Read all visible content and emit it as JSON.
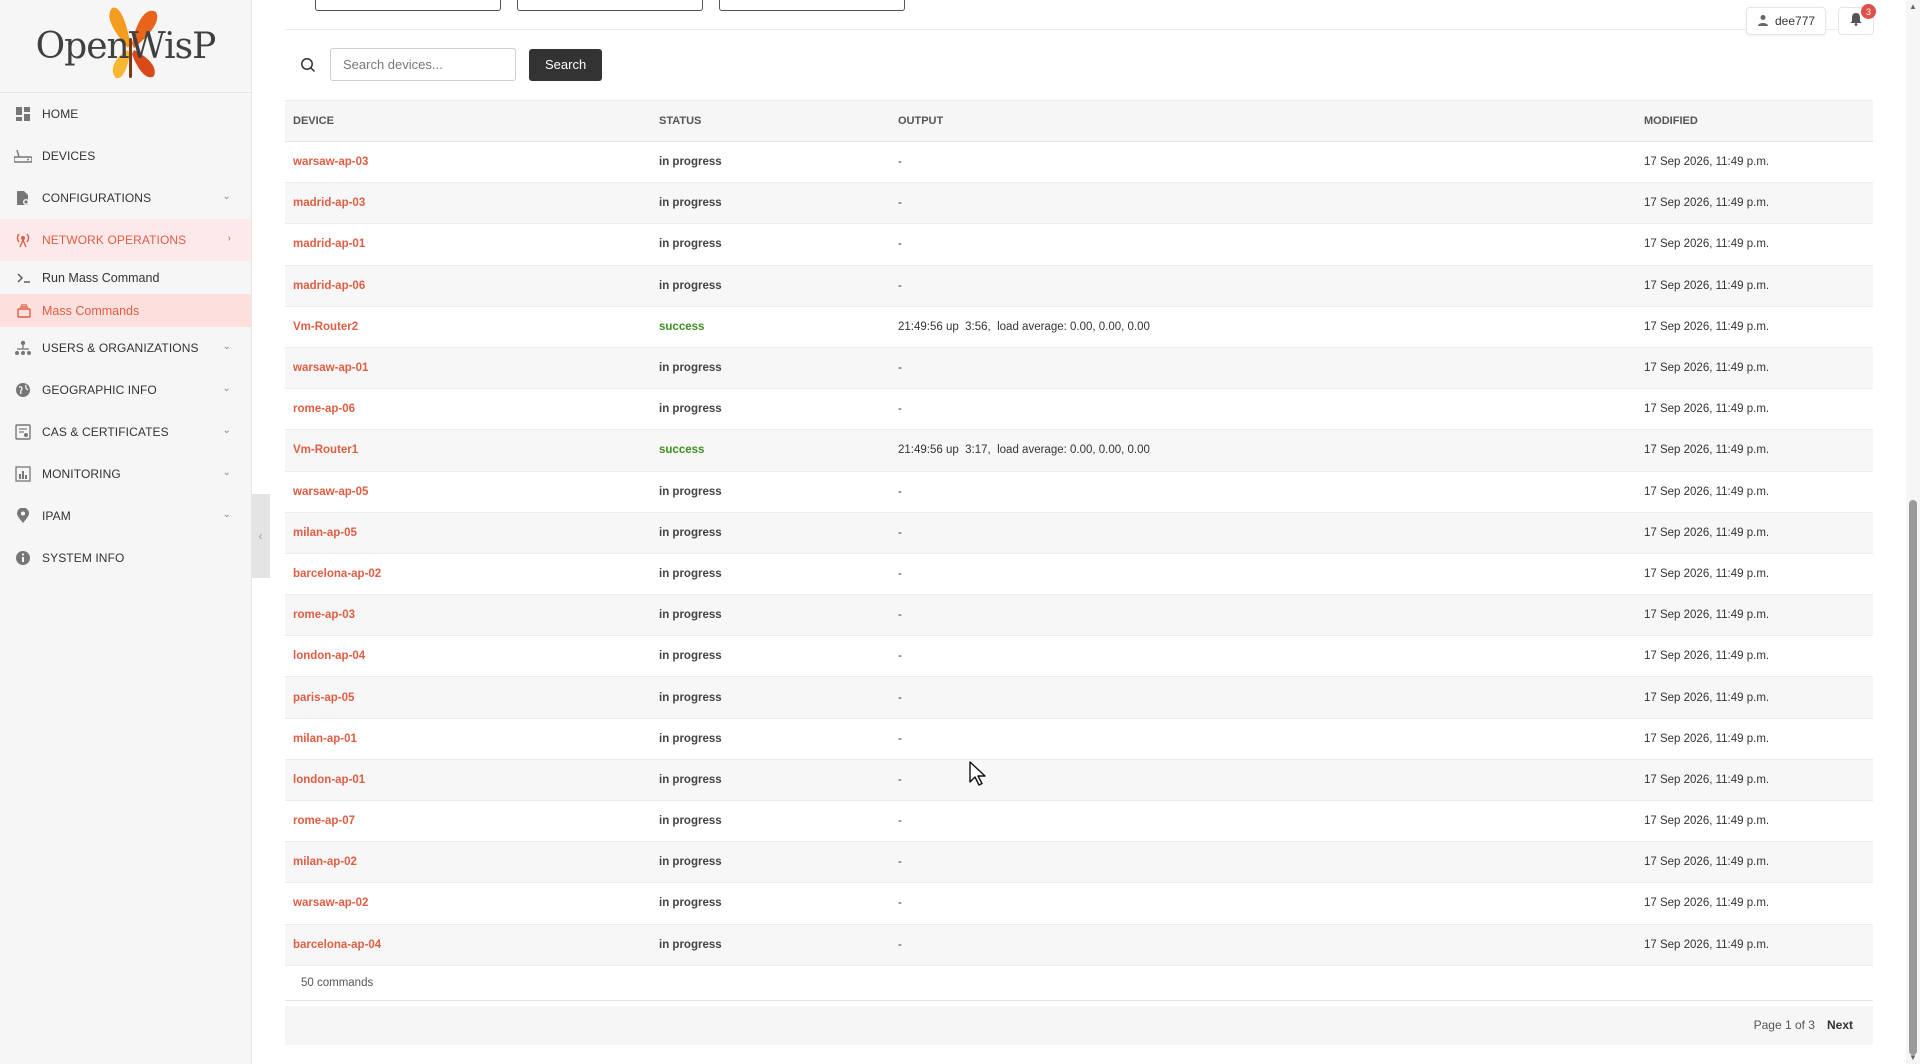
{
  "brand": {
    "logo_text": "OpenWisP"
  },
  "sidebar": {
    "items": [
      {
        "label": "HOME",
        "icon": "dashboard-icon"
      },
      {
        "label": "DEVICES",
        "icon": "router-icon"
      },
      {
        "label": "CONFIGURATIONS",
        "icon": "file-gear-icon"
      },
      {
        "label": "NETWORK OPERATIONS",
        "icon": "antenna-icon"
      },
      {
        "label": "USERS & ORGANIZATIONS",
        "icon": "org-tree-icon"
      },
      {
        "label": "GEOGRAPHIC INFO",
        "icon": "globe-icon"
      },
      {
        "label": "CAS & CERTIFICATES",
        "icon": "certificate-icon"
      },
      {
        "label": "MONITORING",
        "icon": "chart-icon"
      },
      {
        "label": "IPAM",
        "icon": "pin-icon"
      },
      {
        "label": "SYSTEM INFO",
        "icon": "info-icon"
      }
    ],
    "subitems": [
      {
        "label": "Run Mass Command",
        "icon": "terminal-icon"
      },
      {
        "label": "Mass Commands",
        "icon": "stack-icon"
      }
    ]
  },
  "header": {
    "username": "dee777",
    "notification_count": "3"
  },
  "search": {
    "placeholder": "Search devices...",
    "button_label": "Search"
  },
  "table": {
    "columns": [
      "DEVICE",
      "STATUS",
      "OUTPUT",
      "MODIFIED"
    ],
    "rows": [
      {
        "device": "warsaw-ap-03",
        "status": "in progress",
        "output": "-",
        "modified": "17 Sep 2026, 11:49 p.m."
      },
      {
        "device": "madrid-ap-03",
        "status": "in progress",
        "output": "-",
        "modified": "17 Sep 2026, 11:49 p.m."
      },
      {
        "device": "madrid-ap-01",
        "status": "in progress",
        "output": "-",
        "modified": "17 Sep 2026, 11:49 p.m."
      },
      {
        "device": "madrid-ap-06",
        "status": "in progress",
        "output": "-",
        "modified": "17 Sep 2026, 11:49 p.m."
      },
      {
        "device": "Vm-Router2",
        "status": "success",
        "output": "21:49:56 up  3:56,  load average: 0.00, 0.00, 0.00",
        "modified": "17 Sep 2026, 11:49 p.m."
      },
      {
        "device": "warsaw-ap-01",
        "status": "in progress",
        "output": "-",
        "modified": "17 Sep 2026, 11:49 p.m."
      },
      {
        "device": "rome-ap-06",
        "status": "in progress",
        "output": "-",
        "modified": "17 Sep 2026, 11:49 p.m."
      },
      {
        "device": "Vm-Router1",
        "status": "success",
        "output": "21:49:56 up  3:17,  load average: 0.00, 0.00, 0.00",
        "modified": "17 Sep 2026, 11:49 p.m."
      },
      {
        "device": "warsaw-ap-05",
        "status": "in progress",
        "output": "-",
        "modified": "17 Sep 2026, 11:49 p.m."
      },
      {
        "device": "milan-ap-05",
        "status": "in progress",
        "output": "-",
        "modified": "17 Sep 2026, 11:49 p.m."
      },
      {
        "device": "barcelona-ap-02",
        "status": "in progress",
        "output": "-",
        "modified": "17 Sep 2026, 11:49 p.m."
      },
      {
        "device": "rome-ap-03",
        "status": "in progress",
        "output": "-",
        "modified": "17 Sep 2026, 11:49 p.m."
      },
      {
        "device": "london-ap-04",
        "status": "in progress",
        "output": "-",
        "modified": "17 Sep 2026, 11:49 p.m."
      },
      {
        "device": "paris-ap-05",
        "status": "in progress",
        "output": "-",
        "modified": "17 Sep 2026, 11:49 p.m."
      },
      {
        "device": "milan-ap-01",
        "status": "in progress",
        "output": "-",
        "modified": "17 Sep 2026, 11:49 p.m."
      },
      {
        "device": "london-ap-01",
        "status": "in progress",
        "output": "-",
        "modified": "17 Sep 2026, 11:49 p.m."
      },
      {
        "device": "rome-ap-07",
        "status": "in progress",
        "output": "-",
        "modified": "17 Sep 2026, 11:49 p.m."
      },
      {
        "device": "milan-ap-02",
        "status": "in progress",
        "output": "-",
        "modified": "17 Sep 2026, 11:49 p.m."
      },
      {
        "device": "warsaw-ap-02",
        "status": "in progress",
        "output": "-",
        "modified": "17 Sep 2026, 11:49 p.m."
      },
      {
        "device": "barcelona-ap-04",
        "status": "in progress",
        "output": "-",
        "modified": "17 Sep 2026, 11:49 p.m."
      }
    ]
  },
  "footer": {
    "count_label": "50 commands",
    "page_label": "Page 1 of 3",
    "next_label": "Next"
  },
  "colors": {
    "accent": "#df5d43",
    "success": "#3f8f1f",
    "active_bg": "#fde9e9"
  }
}
